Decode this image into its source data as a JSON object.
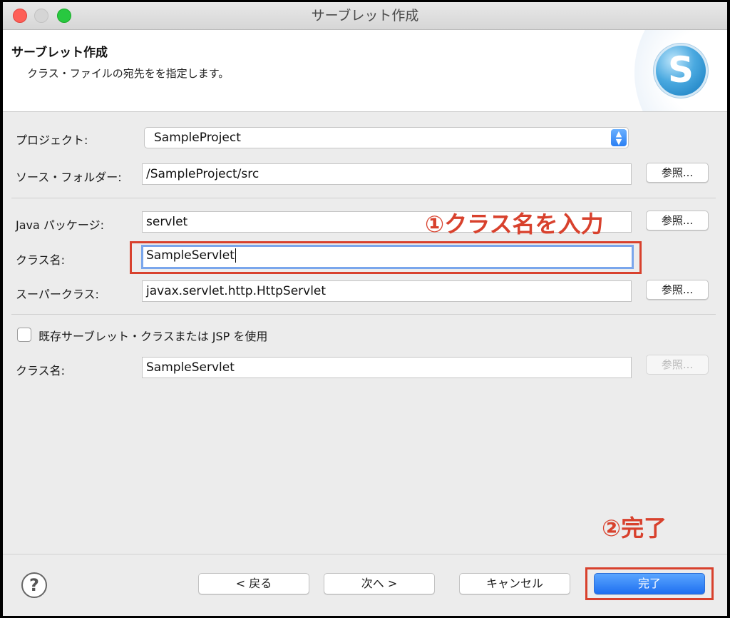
{
  "window": {
    "title": "サーブレット作成"
  },
  "header": {
    "title": "サーブレット作成",
    "description": "クラス・ファイルの宛先をを指定します。",
    "logo_letter": "S"
  },
  "form": {
    "project": {
      "label": "プロジェクト:",
      "value": "SampleProject"
    },
    "source_folder": {
      "label": "ソース・フォルダー:",
      "value": "/SampleProject/src",
      "browse": "参照..."
    },
    "java_package": {
      "label": "Java パッケージ:",
      "value": "servlet",
      "browse": "参照..."
    },
    "class_name": {
      "label": "クラス名:",
      "value": "SampleServlet"
    },
    "superclass": {
      "label": "スーパークラス:",
      "value": "javax.servlet.http.HttpServlet",
      "browse": "参照..."
    },
    "use_existing": {
      "label": "既存サーブレット・クラスまたは JSP を使用",
      "checked": false
    },
    "existing_class": {
      "label": "クラス名:",
      "value": "SampleServlet",
      "browse": "参照..."
    }
  },
  "annotations": {
    "step1": "①クラス名を入力",
    "step2": "②完了"
  },
  "footer": {
    "help": "?",
    "back": "< 戻る",
    "next": "次へ >",
    "cancel": "キャンセル",
    "finish": "完了"
  },
  "colors": {
    "annotation": "#d8412d",
    "accent": "#2a7ff3"
  }
}
